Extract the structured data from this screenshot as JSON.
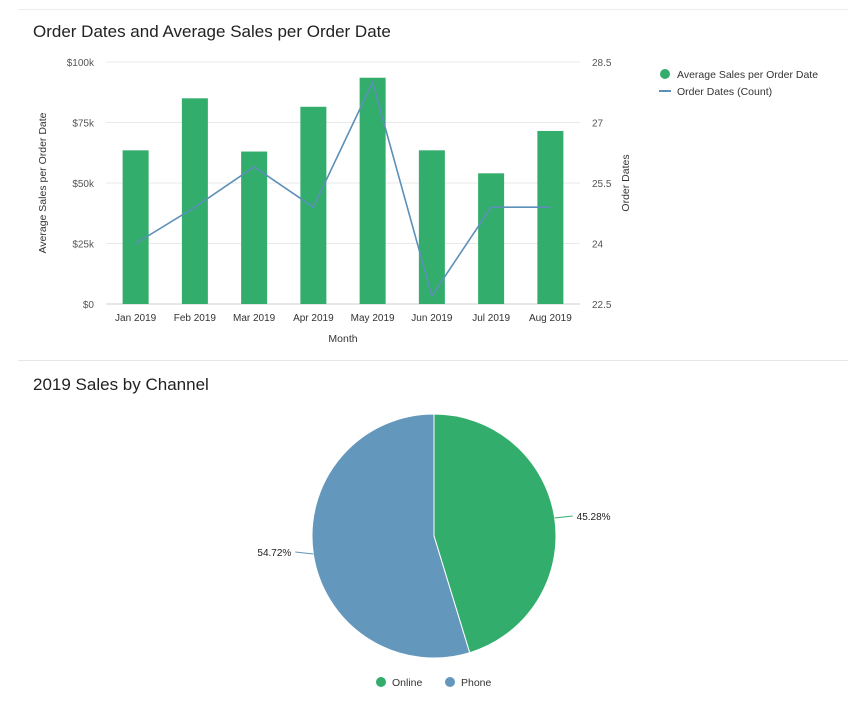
{
  "panels": [
    {
      "title": "Order Dates and Average Sales per Order Date"
    },
    {
      "title": "2019 Sales by Channel"
    }
  ],
  "chart_data": [
    {
      "type": "bar",
      "title": "Order Dates and Average Sales per Order Date",
      "xlabel": "Month",
      "ylabel": "Average Sales per Order Date",
      "y2label": "Order Dates",
      "categories": [
        "Jan 2019",
        "Feb 2019",
        "Mar 2019",
        "Apr 2019",
        "May 2019",
        "Jun 2019",
        "Jul 2019",
        "Aug 2019"
      ],
      "series": [
        {
          "name": "Average Sales per Order Date",
          "type": "bar",
          "axis": "left",
          "color": "#33ad6b",
          "values": [
            63500,
            85000,
            63000,
            81500,
            93500,
            63500,
            54000,
            71500
          ]
        },
        {
          "name": "Order Dates (Count)",
          "type": "line",
          "axis": "right",
          "color": "#5b90b8",
          "values": [
            24,
            24.9,
            25.9,
            24.9,
            28,
            22.7,
            24.9,
            24.9
          ]
        }
      ],
      "ylim": [
        0,
        100000
      ],
      "yticks": [
        0,
        25000,
        50000,
        75000,
        100000
      ],
      "yticklabels": [
        "$0",
        "$25k",
        "$50k",
        "$75k",
        "$100k"
      ],
      "y2lim": [
        22.5,
        28.5
      ],
      "y2ticks": [
        22.5,
        24,
        25.5,
        27,
        28.5
      ],
      "y2ticklabels": [
        "22.5",
        "24",
        "25.5",
        "27",
        "28.5"
      ],
      "grid": true,
      "legend": "top-right"
    },
    {
      "type": "pie",
      "title": "2019 Sales by Channel",
      "labels": [
        "Online",
        "Phone"
      ],
      "values": [
        45.28,
        54.72
      ],
      "value_labels": [
        "45.28%",
        "54.72%"
      ],
      "colors": [
        "#33ad6b",
        "#6397bb"
      ],
      "legend": "bottom"
    }
  ]
}
